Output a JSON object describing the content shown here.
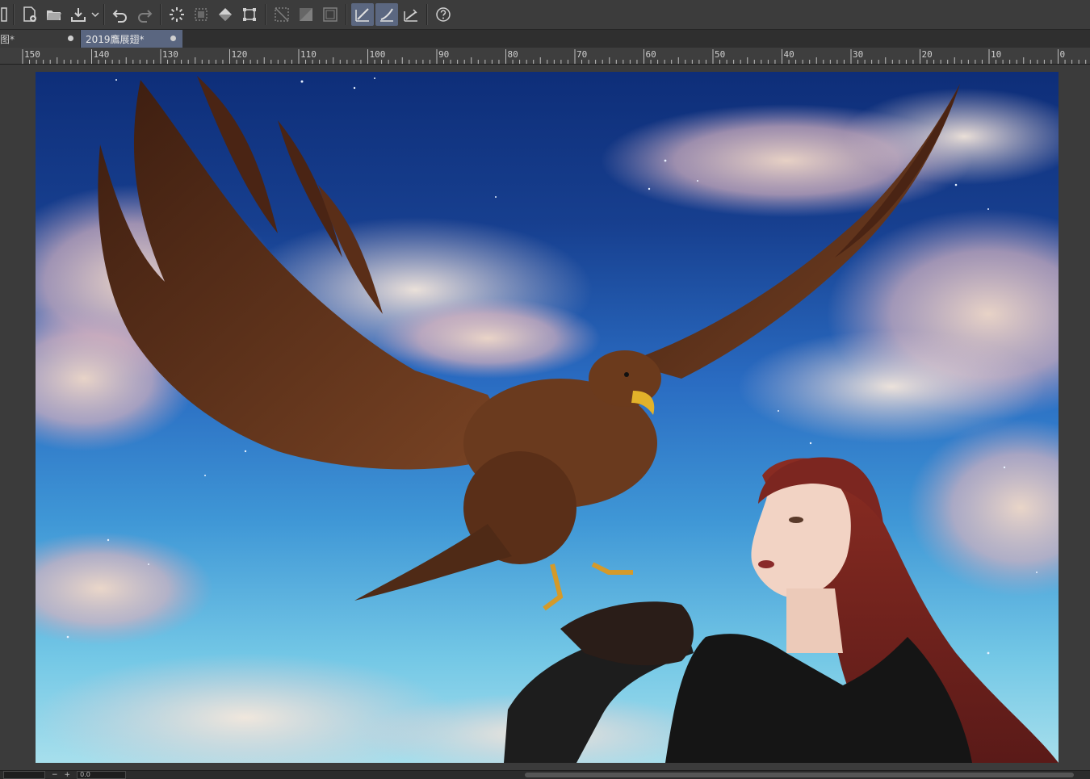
{
  "toolbar": {
    "buttons": [
      {
        "name": "new-canvas-icon"
      },
      {
        "name": "open-icon"
      },
      {
        "name": "save-icon"
      },
      {
        "name": "undo-icon"
      },
      {
        "name": "redo-icon"
      },
      {
        "name": "loading-icon"
      },
      {
        "name": "select-all-icon"
      },
      {
        "name": "fill-icon"
      },
      {
        "name": "transform-icon"
      },
      {
        "name": "clear-selection-icon"
      },
      {
        "name": "invert-selection-icon"
      },
      {
        "name": "selection-border-icon"
      },
      {
        "name": "snap-ruler-icon"
      },
      {
        "name": "snap-special-ruler-icon"
      },
      {
        "name": "snap-grid-icon"
      },
      {
        "name": "help-icon"
      }
    ]
  },
  "tabs": [
    {
      "label": "图*",
      "active": false
    },
    {
      "label": "2019鷹展翅*",
      "active": true
    }
  ],
  "ruler": {
    "labels": [
      "150",
      "140",
      "130",
      "120",
      "110",
      "100",
      "90",
      "80",
      "70",
      "60",
      "50",
      "40",
      "30",
      "20",
      "10",
      "0"
    ]
  },
  "status": {
    "zoom_value": "0.0"
  },
  "colors": {
    "toolbar_bg": "#3c3c3c",
    "tab_active_bg": "#5a6680",
    "button_active_bg": "#5b6780"
  }
}
